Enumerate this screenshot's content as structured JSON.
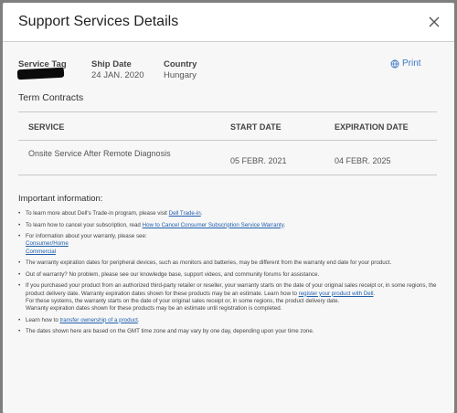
{
  "modal": {
    "title": "Support Services Details",
    "close_icon": "close-icon"
  },
  "fields": {
    "service_tag": {
      "label": "Service Tag"
    },
    "ship_date": {
      "label": "Ship Date",
      "value": "24 JAN. 2020"
    },
    "country": {
      "label": "Country",
      "value": "Hungary"
    }
  },
  "print": {
    "label": "Print",
    "icon": "globe-icon"
  },
  "term_contracts": {
    "heading": "Term Contracts",
    "columns": [
      "SERVICE",
      "START DATE",
      "EXPIRATION DATE"
    ],
    "rows": [
      {
        "service": "Onsite Service After Remote Diagnosis",
        "start": "05 FEBR. 2021",
        "end": "04 FEBR. 2025"
      }
    ]
  },
  "info": {
    "heading": "Important information:",
    "items": [
      {
        "pre": "To learn more about Dell's Trade-in program, please visit ",
        "link": "Dell Trade-in",
        "post": "."
      },
      {
        "pre": "To learn how to cancel your subscription, read ",
        "link": "How to Cancel Consumer Subscription Service Warranty",
        "post": "."
      },
      {
        "text": "For information about your warranty, please see:",
        "link1": "Consumer/Home",
        "link2": "Commercial"
      },
      {
        "text": "The warranty expiration dates for peripheral devices, such as monitors and batteries, may be different from the warranty end date for your product."
      },
      {
        "text": "Out of warranty? No problem, please see our knowledge base, support videos, and community forums for assistance."
      },
      {
        "pre": "If you purchased your product from an authorized third-party retailer or reseller, your warranty starts on the date of your original sales receipt or, in some regions, the product delivery date. Warranty expiration dates shown for these products may be an estimate. Learn how to ",
        "link": "register your product with Dell",
        "post": ".",
        "line2": "For these systems, the warranty starts on the date of your original sales receipt or, in some regions, the product delivery date.",
        "line3": "Warranty expiration dates shown for these products may be an estimate until registration is completed."
      },
      {
        "pre": "Learn how to ",
        "link": "transfer ownership of a product",
        "post": "."
      },
      {
        "text": "The dates shown here are based on the GMT time zone and may vary by one day, depending upon your time zone."
      }
    ]
  }
}
